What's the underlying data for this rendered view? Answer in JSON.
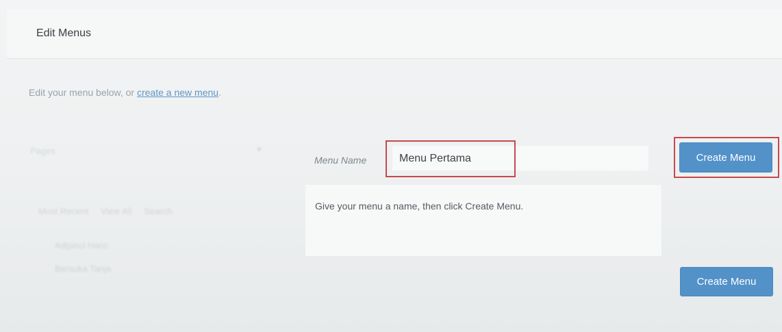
{
  "page": {
    "title": "Edit Menus",
    "intro_prefix": "Edit your menu below, or",
    "intro_link": "create a new menu",
    "intro_suffix": "."
  },
  "sidebar": {
    "select_label": "Pages",
    "tabs": [
      "Most Recent",
      "View All",
      "Search"
    ],
    "items": [
      "Adipisci Hanc",
      "Bersuka Tanja"
    ]
  },
  "menu_editor": {
    "name_label": "Menu Name",
    "name_value": "Menu Pertama",
    "create_button_top": "Create Menu",
    "help_text": "Give your menu a name, then click Create Menu.",
    "create_button_bottom": "Create Menu"
  },
  "colors": {
    "accent": "#5292c9",
    "highlight": "#c6484d",
    "link": "#5f95c7"
  }
}
